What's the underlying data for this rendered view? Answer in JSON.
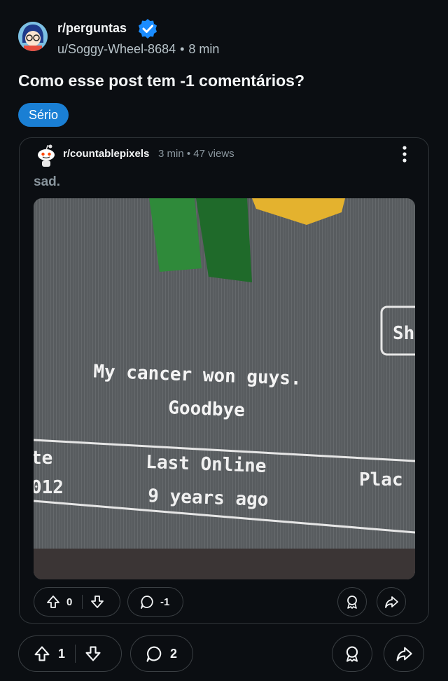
{
  "post": {
    "subreddit": "r/perguntas",
    "author": "u/Soggy-Wheel-8684",
    "separator": "•",
    "age": "8 min",
    "title": "Como esse post tem -1 comentários?",
    "flair": "Sério"
  },
  "embedded": {
    "subreddit": "r/countablepixels",
    "age": "3 min",
    "separator": "•",
    "views": "47 views",
    "text": "sad.",
    "image": {
      "line1": "My cancer won guys.",
      "line2": "Goodbye",
      "col_left_head": "te",
      "col_left_value": "012",
      "col_mid_head": "Last Online",
      "col_mid_value": "9 years ago",
      "col_right_head": "Plac",
      "button_partial": "Sh"
    },
    "votes": "0",
    "comments": "-1"
  },
  "actions": {
    "votes": "1",
    "comments": "2"
  },
  "colors": {
    "background": "#0b0e12",
    "flair": "#1a7fd4",
    "verified": "#1a8cff",
    "muted": "#8a969e"
  },
  "icons": {
    "verified": "verified-badge-icon",
    "upvote": "upvote-arrow-icon",
    "downvote": "downvote-arrow-icon",
    "comment": "comment-bubble-icon",
    "award": "award-icon",
    "share": "share-arrow-icon",
    "more": "more-vertical-icon"
  }
}
